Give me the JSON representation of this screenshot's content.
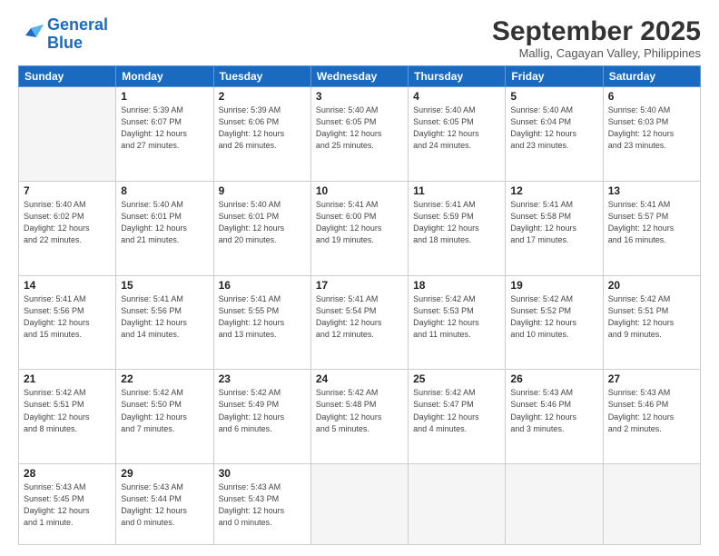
{
  "logo": {
    "line1": "General",
    "line2": "Blue"
  },
  "title": "September 2025",
  "subtitle": "Mallig, Cagayan Valley, Philippines",
  "days_of_week": [
    "Sunday",
    "Monday",
    "Tuesday",
    "Wednesday",
    "Thursday",
    "Friday",
    "Saturday"
  ],
  "weeks": [
    [
      {
        "day": "",
        "info": ""
      },
      {
        "day": "1",
        "info": "Sunrise: 5:39 AM\nSunset: 6:07 PM\nDaylight: 12 hours\nand 27 minutes."
      },
      {
        "day": "2",
        "info": "Sunrise: 5:39 AM\nSunset: 6:06 PM\nDaylight: 12 hours\nand 26 minutes."
      },
      {
        "day": "3",
        "info": "Sunrise: 5:40 AM\nSunset: 6:05 PM\nDaylight: 12 hours\nand 25 minutes."
      },
      {
        "day": "4",
        "info": "Sunrise: 5:40 AM\nSunset: 6:05 PM\nDaylight: 12 hours\nand 24 minutes."
      },
      {
        "day": "5",
        "info": "Sunrise: 5:40 AM\nSunset: 6:04 PM\nDaylight: 12 hours\nand 23 minutes."
      },
      {
        "day": "6",
        "info": "Sunrise: 5:40 AM\nSunset: 6:03 PM\nDaylight: 12 hours\nand 23 minutes."
      }
    ],
    [
      {
        "day": "7",
        "info": "Sunrise: 5:40 AM\nSunset: 6:02 PM\nDaylight: 12 hours\nand 22 minutes."
      },
      {
        "day": "8",
        "info": "Sunrise: 5:40 AM\nSunset: 6:01 PM\nDaylight: 12 hours\nand 21 minutes."
      },
      {
        "day": "9",
        "info": "Sunrise: 5:40 AM\nSunset: 6:01 PM\nDaylight: 12 hours\nand 20 minutes."
      },
      {
        "day": "10",
        "info": "Sunrise: 5:41 AM\nSunset: 6:00 PM\nDaylight: 12 hours\nand 19 minutes."
      },
      {
        "day": "11",
        "info": "Sunrise: 5:41 AM\nSunset: 5:59 PM\nDaylight: 12 hours\nand 18 minutes."
      },
      {
        "day": "12",
        "info": "Sunrise: 5:41 AM\nSunset: 5:58 PM\nDaylight: 12 hours\nand 17 minutes."
      },
      {
        "day": "13",
        "info": "Sunrise: 5:41 AM\nSunset: 5:57 PM\nDaylight: 12 hours\nand 16 minutes."
      }
    ],
    [
      {
        "day": "14",
        "info": "Sunrise: 5:41 AM\nSunset: 5:56 PM\nDaylight: 12 hours\nand 15 minutes."
      },
      {
        "day": "15",
        "info": "Sunrise: 5:41 AM\nSunset: 5:56 PM\nDaylight: 12 hours\nand 14 minutes."
      },
      {
        "day": "16",
        "info": "Sunrise: 5:41 AM\nSunset: 5:55 PM\nDaylight: 12 hours\nand 13 minutes."
      },
      {
        "day": "17",
        "info": "Sunrise: 5:41 AM\nSunset: 5:54 PM\nDaylight: 12 hours\nand 12 minutes."
      },
      {
        "day": "18",
        "info": "Sunrise: 5:42 AM\nSunset: 5:53 PM\nDaylight: 12 hours\nand 11 minutes."
      },
      {
        "day": "19",
        "info": "Sunrise: 5:42 AM\nSunset: 5:52 PM\nDaylight: 12 hours\nand 10 minutes."
      },
      {
        "day": "20",
        "info": "Sunrise: 5:42 AM\nSunset: 5:51 PM\nDaylight: 12 hours\nand 9 minutes."
      }
    ],
    [
      {
        "day": "21",
        "info": "Sunrise: 5:42 AM\nSunset: 5:51 PM\nDaylight: 12 hours\nand 8 minutes."
      },
      {
        "day": "22",
        "info": "Sunrise: 5:42 AM\nSunset: 5:50 PM\nDaylight: 12 hours\nand 7 minutes."
      },
      {
        "day": "23",
        "info": "Sunrise: 5:42 AM\nSunset: 5:49 PM\nDaylight: 12 hours\nand 6 minutes."
      },
      {
        "day": "24",
        "info": "Sunrise: 5:42 AM\nSunset: 5:48 PM\nDaylight: 12 hours\nand 5 minutes."
      },
      {
        "day": "25",
        "info": "Sunrise: 5:42 AM\nSunset: 5:47 PM\nDaylight: 12 hours\nand 4 minutes."
      },
      {
        "day": "26",
        "info": "Sunrise: 5:43 AM\nSunset: 5:46 PM\nDaylight: 12 hours\nand 3 minutes."
      },
      {
        "day": "27",
        "info": "Sunrise: 5:43 AM\nSunset: 5:46 PM\nDaylight: 12 hours\nand 2 minutes."
      }
    ],
    [
      {
        "day": "28",
        "info": "Sunrise: 5:43 AM\nSunset: 5:45 PM\nDaylight: 12 hours\nand 1 minute."
      },
      {
        "day": "29",
        "info": "Sunrise: 5:43 AM\nSunset: 5:44 PM\nDaylight: 12 hours\nand 0 minutes."
      },
      {
        "day": "30",
        "info": "Sunrise: 5:43 AM\nSunset: 5:43 PM\nDaylight: 12 hours\nand 0 minutes."
      },
      {
        "day": "",
        "info": ""
      },
      {
        "day": "",
        "info": ""
      },
      {
        "day": "",
        "info": ""
      },
      {
        "day": "",
        "info": ""
      }
    ]
  ]
}
